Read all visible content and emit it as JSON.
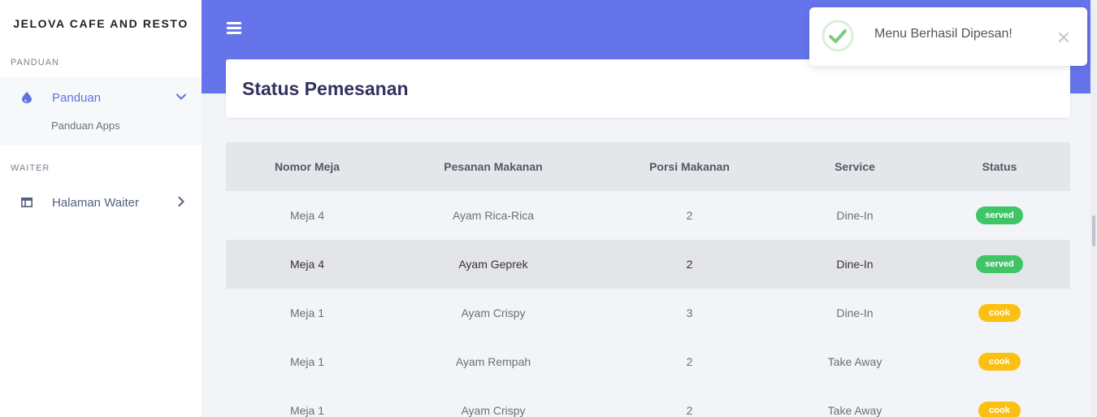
{
  "sidebar": {
    "brand": "JELOVA CAFE AND RESTO",
    "section_panduan": "PANDUAN",
    "nav_panduan": "Panduan",
    "sub_panduan_apps": "Panduan Apps",
    "section_waiter": "WAITER",
    "nav_halaman_waiter": "Halaman Waiter"
  },
  "page": {
    "title": "Status Pemesanan"
  },
  "table": {
    "headers": [
      "Nomor Meja",
      "Pesanan Makanan",
      "Porsi Makanan",
      "Service",
      "Status"
    ],
    "rows": [
      [
        "Meja 4",
        "Ayam Rica-Rica",
        "2",
        "Dine-In",
        "served"
      ],
      [
        "Meja 4",
        "Ayam Geprek",
        "2",
        "Dine-In",
        "served"
      ],
      [
        "Meja 1",
        "Ayam Crispy",
        "3",
        "Dine-In",
        "cook"
      ],
      [
        "Meja 1",
        "Ayam Rempah",
        "2",
        "Take Away",
        "cook"
      ],
      [
        "Meja 1",
        "Ayam Crispy",
        "2",
        "Take Away",
        "cook"
      ]
    ]
  },
  "toast": {
    "message": "Menu Berhasil Dipesan!"
  },
  "icons": {
    "menu": "hamburger-icon",
    "panduan": "drop-icon",
    "waiter": "layout-icon",
    "expand": "chevron-down-icon",
    "collapse": "chevron-right-icon",
    "success": "check-circle-icon",
    "close": "close-icon"
  },
  "colors": {
    "accent": "#5e72e4",
    "topbar": "#6674ec",
    "served": "#3fc566",
    "cook": "#fbc112"
  }
}
